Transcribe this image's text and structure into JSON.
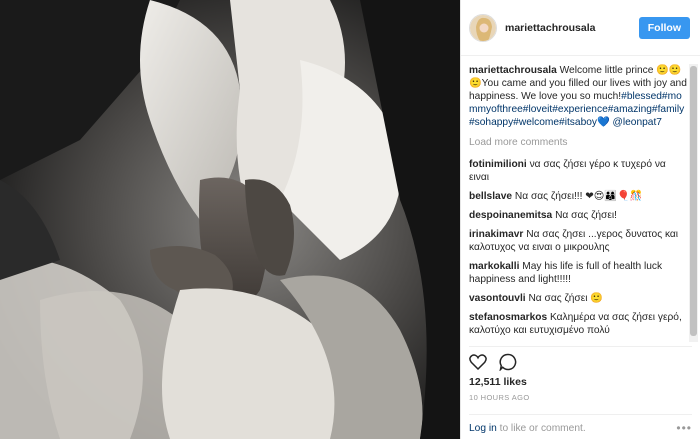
{
  "post": {
    "username": "mariettachrousala",
    "follow_label": "Follow",
    "caption_user": "mariettachrousala",
    "caption_text": "Welcome little prince 🙂🙂🙂You came and you filled our lives with joy and happiness. We love you so much!",
    "hashtags": "#blessed#mommyofthree#loveit#experience#amazing#family#sohappy#welcome#itsaboy",
    "caption_emoji": "💙",
    "mention": "@leonpat7",
    "load_more": "Load more comments",
    "likes": "12,511 likes",
    "timestamp": "10 HOURS AGO"
  },
  "comments": [
    {
      "user": "fotinimilioni",
      "text": "να σας ζήσει γέρο κ τυχερό να ειναι"
    },
    {
      "user": "bellslave",
      "text": "Να σας ζήσει!!! ❤😍👨‍👩‍👦🎈🎊"
    },
    {
      "user": "despoinanemitsa",
      "text": "Να σας ζήσει!"
    },
    {
      "user": "irinakimavr",
      "text": "Να σας ζησει ...γερος δυνατος και καλοτυχος να ειναι ο μικρουλης"
    },
    {
      "user": "markokalli",
      "text": "May his life is full of health luck happiness and light!!!!!"
    },
    {
      "user": "vasontouvli",
      "text": "Να σας ζήσει 🙂"
    },
    {
      "user": "stefanosmarkos",
      "text": "Καλημέρα να σας ζήσει γερό, καλοτύχο και ευτυχισμένο πολύ"
    }
  ],
  "footer": {
    "login": "Log in",
    "suffix": "to like or comment.",
    "more": "•••"
  },
  "icons": [
    "heart-icon",
    "comment-icon",
    "more-icon"
  ]
}
